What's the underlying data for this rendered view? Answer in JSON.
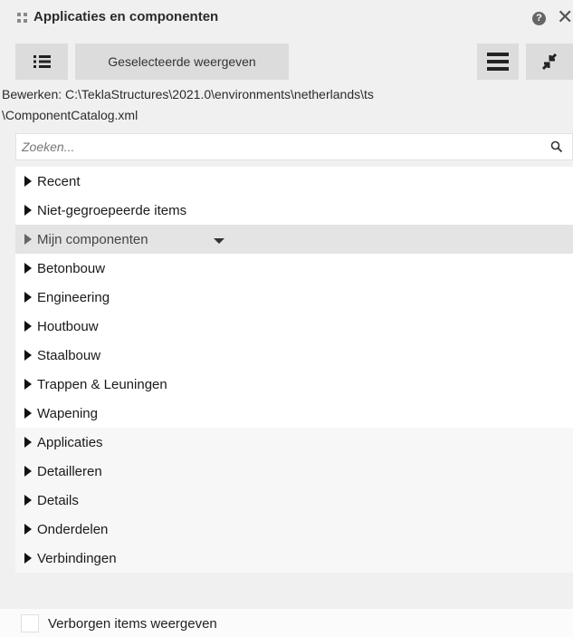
{
  "panel": {
    "title": "Applicaties en componenten",
    "help_glyph": "?",
    "close_glyph": "✕"
  },
  "toolbar": {
    "list_icon": "list-icon",
    "show_selected_label": "Geselecteerde weergeven",
    "menu_icon": "hamburger-menu-icon",
    "collapse_icon": "collapse-arrows-icon"
  },
  "catalog": {
    "edit_path_line1": "Bewerken:  C:\\TeklaStructures\\2021.0\\environments\\netherlands\\ts",
    "edit_path_line2": "\\ComponentCatalog.xml"
  },
  "search": {
    "placeholder": "Zoeken...",
    "value": ""
  },
  "tree": {
    "items": [
      {
        "label": "Recent"
      },
      {
        "label": "Niet-gegroepeerde items"
      },
      {
        "label": "Mijn componenten"
      },
      {
        "label": "Betonbouw"
      },
      {
        "label": "Engineering"
      },
      {
        "label": "Houtbouw"
      },
      {
        "label": "Staalbouw"
      },
      {
        "label": "Trappen & Leuningen"
      },
      {
        "label": "Wapening"
      },
      {
        "label": "Applicaties"
      },
      {
        "label": "Detailleren"
      },
      {
        "label": "Details"
      },
      {
        "label": "Onderdelen"
      },
      {
        "label": "Verbindingen"
      }
    ]
  },
  "footer": {
    "show_hidden_label": "Verborgen items weergeven",
    "show_hidden_checked": false
  }
}
